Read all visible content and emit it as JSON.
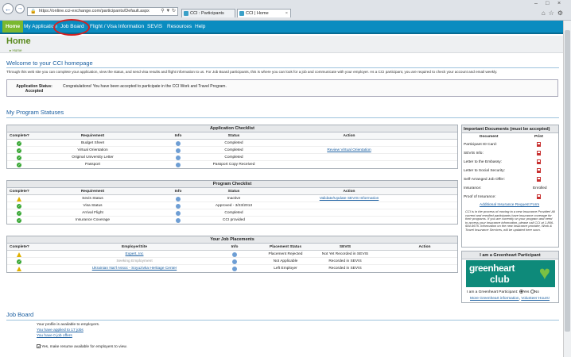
{
  "browser": {
    "url": "https://online.cci-exchange.com/participants/Default.aspx",
    "tabs": [
      {
        "label": "CCI : Participants"
      },
      {
        "label": "CCI | Home"
      }
    ]
  },
  "nav": {
    "items": [
      "Home",
      "My Application",
      "Job Board",
      "Flight / Visa Information",
      "SEVIS",
      "Resources",
      "Help"
    ]
  },
  "page": {
    "title": "Home",
    "breadcrumb": "▸ Home"
  },
  "welcome": {
    "heading": "Welcome to your CCI homepage",
    "intro": "Through this web site you can complete your application, view the status, and send visa results and flight information to us. For Job Board participants, this is where you can look for a job and communicate with your employer. As a CCI participant, you are required to check your account and email weekly.",
    "status_label": "Application Status:",
    "status_value": "Accepted",
    "status_message": "Congratulations! You have been accepted to participate in the CCI Work and Travel Program."
  },
  "program": {
    "heading": "My Program Statuses",
    "application_checklist": {
      "title": "Application Checklist",
      "columns": [
        "Complete?",
        "Requirement",
        "Info",
        "Status",
        "Action"
      ],
      "rows": [
        {
          "state": "ok",
          "requirement": "Budget Sheet",
          "status": "Completed",
          "action": ""
        },
        {
          "state": "ok",
          "requirement": "Virtual Orientation",
          "status": "Completed",
          "action": "Review Virtual Orientation"
        },
        {
          "state": "ok",
          "requirement": "Original University Letter",
          "status": "Completed",
          "action": ""
        },
        {
          "state": "ok",
          "requirement": "Passport",
          "status": "Passport Copy Received",
          "action": ""
        }
      ]
    },
    "program_checklist": {
      "title": "Program Checklist",
      "columns": [
        "Complete?",
        "Requirement",
        "Info",
        "Status",
        "Action"
      ],
      "rows": [
        {
          "state": "warn",
          "requirement": "Sevis Status",
          "status": "Inactive",
          "action": "Validate/Update SEVIS Information"
        },
        {
          "state": "ok",
          "requirement": "Visa Status",
          "status": "Approved - 3/23/2013",
          "action": ""
        },
        {
          "state": "ok",
          "requirement": "Arrival Flight",
          "status": "Completed",
          "action": ""
        },
        {
          "state": "ok",
          "requirement": "Insurance Coverage",
          "status": "CCI provided",
          "action": ""
        }
      ]
    },
    "job_placements": {
      "title": "Your Job Placements",
      "columns": [
        "Complete?",
        "Employer/Site",
        "Info",
        "Placement Status",
        "SEVIS",
        "Action"
      ],
      "rows": [
        {
          "state": "warn",
          "employer": "Expert, Inc",
          "employer_style": "link",
          "placement": "Placement Rejected",
          "sevis": "Not Yet Recorded in SEVIS"
        },
        {
          "state": "ok",
          "employer": "Seeking Employment",
          "employer_style": "grey",
          "placement": "Not Applicable",
          "sevis": "Recorded in SEVIS"
        },
        {
          "state": "warn",
          "employer": "Ukrainian Nat'l Assoc - Soyuzivka Heritage Center",
          "employer_style": "link",
          "placement": "Left Employer",
          "sevis": "Recorded in SEVIS"
        }
      ]
    }
  },
  "documents": {
    "title": "Important Documents (must be accepted)",
    "col_document": "Document",
    "col_print": "Print",
    "rows": [
      {
        "label": "Participant ID Card:",
        "print": "pdf"
      },
      {
        "label": "SEVIS Info:",
        "print": "pdf"
      },
      {
        "label": "Letter to the Embassy:",
        "print": "pdf"
      },
      {
        "label": "Letter to Social Security:",
        "print": "pdf"
      },
      {
        "label": "Self-Arranged Job Offer:",
        "print": "pdf"
      },
      {
        "label": "Insurance:",
        "print": "Enrolled"
      },
      {
        "label": "Proof of Insurance:",
        "print": "pdf"
      }
    ],
    "insurance_link": "Additional Insurance Request Form",
    "note": "CCI is in the process of moving to a new Insurance Provider! All current and enrolled participants have insurance coverage for their programs. If you are currently on your program and need to access your insurance information, please call CCI at 1-866-684-9675. Information on the new insurance provider, Work & Travel Insurance Services, will be updated here soon."
  },
  "greenheart": {
    "title": "I am a Greenheart Participant",
    "logo_line1": "greenheart",
    "logo_line2": "club",
    "question": "I am a Greenheart Participant:",
    "yes": "Yes",
    "no": "No",
    "link_more": "More Greenheart information",
    "link_volunteer": "Volunteer Hours!"
  },
  "jobboard": {
    "heading": "Job Board",
    "profile_text": "Your profile is available to employers.",
    "applied_link": "You have applied to 17 jobs",
    "offers_link": "You have 0 job offers",
    "resume_label": "Yes, make resume available for employers to view."
  }
}
